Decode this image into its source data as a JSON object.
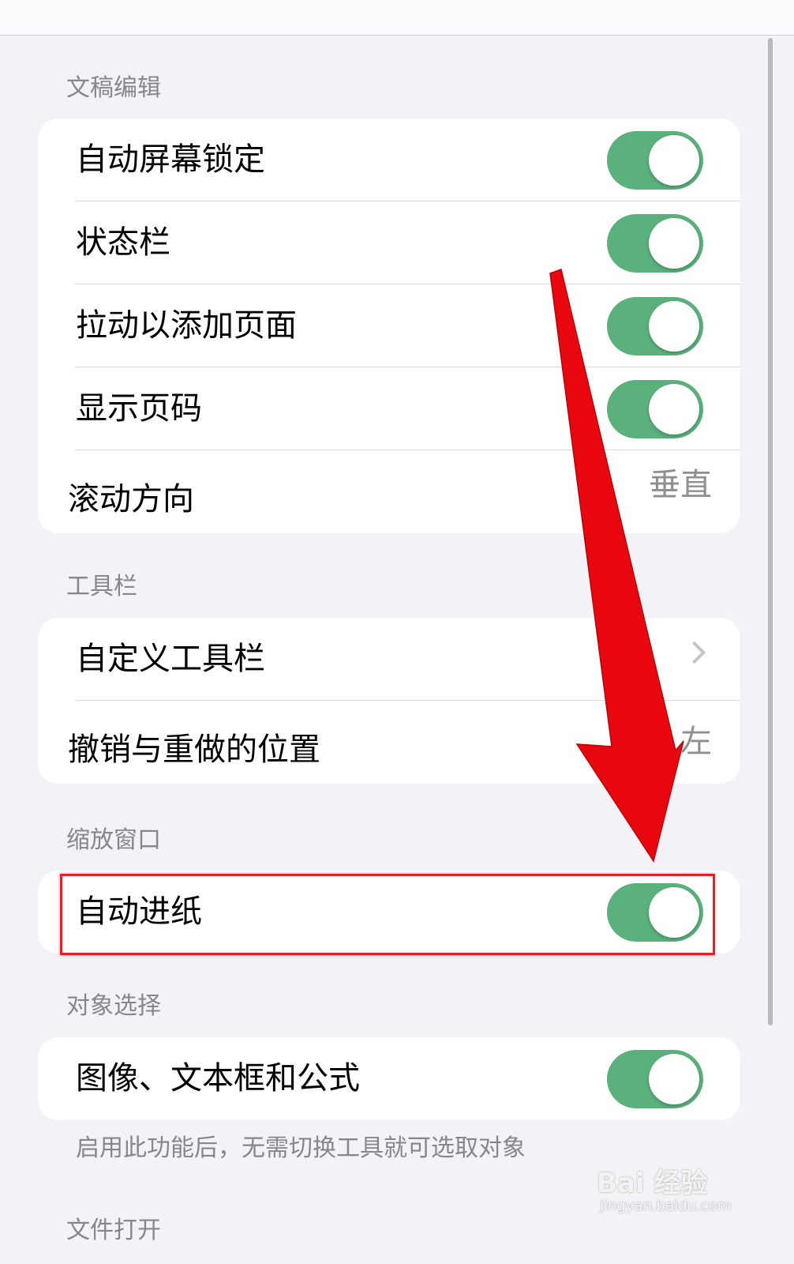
{
  "sections": {
    "doc_edit": {
      "header": "文稿编辑",
      "rows": [
        {
          "label": "自动屏幕锁定",
          "toggle_on": true
        },
        {
          "label": "状态栏",
          "toggle_on": true
        },
        {
          "label": "拉动以添加页面",
          "toggle_on": true
        },
        {
          "label": "显示页码",
          "toggle_on": true
        },
        {
          "label": "滚动方向",
          "value": "垂直"
        }
      ]
    },
    "toolbar": {
      "header": "工具栏",
      "rows": [
        {
          "label": "自定义工具栏"
        },
        {
          "label": "撤销与重做的位置",
          "value": "左"
        }
      ]
    },
    "zoom_window": {
      "header": "缩放窗口",
      "rows": [
        {
          "label": "自动进纸",
          "toggle_on": true
        }
      ]
    },
    "object_select": {
      "header": "对象选择",
      "rows": [
        {
          "label": "图像、文本框和公式",
          "toggle_on": true
        }
      ],
      "footer": "启用此功能后，无需切换工具就可选取对象"
    },
    "file_open": {
      "header": "文件打开"
    }
  },
  "colors": {
    "toggle_on": "#5bb17c",
    "annotation_red": "#e3202a"
  },
  "watermark": {
    "brand": "Bai 经验",
    "url": "jingyan.baidu.com"
  }
}
